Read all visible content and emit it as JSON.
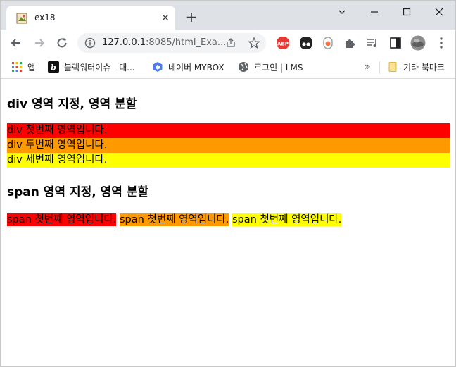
{
  "tab": {
    "title": "ex18"
  },
  "omnibox": {
    "url_host": "127.0.0.1",
    "url_rest": ":8085/html_Exa..."
  },
  "bookmarks": [
    {
      "label": "앱"
    },
    {
      "label": "블랙워터이슈 - 대..."
    },
    {
      "label": "네이버 MYBOX"
    },
    {
      "label": "로그인 | LMS"
    }
  ],
  "bookmarks_overflow": "»",
  "other_bookmarks": "기타 북마크",
  "page": {
    "heading1": "div 영역 지정, 영역 분할",
    "divs": [
      {
        "text": "div 첫번째 영역입니다.",
        "color": "#ff0000"
      },
      {
        "text": "div 두번째 영역입니다.",
        "color": "#ff9900"
      },
      {
        "text": "div 세번째 영역입니다.",
        "color": "#ffff00"
      }
    ],
    "heading2": "span 영역 지정, 영역 분할",
    "spans": [
      {
        "text": "span 첫번째 영역입니다.",
        "color": "#ff0000"
      },
      {
        "text": "span 첫번째 영역입니다.",
        "color": "#ff9900"
      },
      {
        "text": "span 첫번째 영역입니다.",
        "color": "#ffff00"
      }
    ]
  }
}
